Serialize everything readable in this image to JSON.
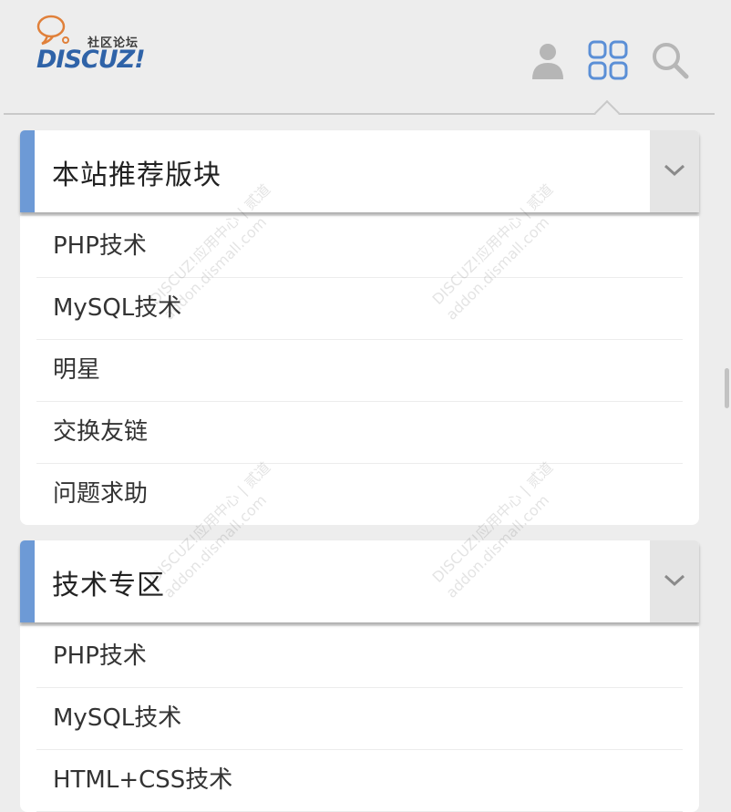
{
  "header": {
    "logo_text": "DISCUZ!",
    "logo_sub": "社区论坛",
    "icons": [
      "user-icon",
      "grid-icon",
      "search-icon"
    ]
  },
  "sections": [
    {
      "title": "本站推荐版块",
      "items": [
        "PHP技术",
        "MySQL技术",
        "明星",
        "交换友链",
        "问题求助"
      ]
    },
    {
      "title": "技术专区",
      "items": [
        "PHP技术",
        "MySQL技术",
        "HTML+CSS技术"
      ]
    }
  ],
  "watermark": {
    "brand": "DISCUZ!应用中心",
    "url": "addon.dismall.com",
    "tag": "贰道"
  },
  "colors": {
    "accent": "#6d9ad6",
    "logo_blue": "#2f63a8",
    "icon_blue": "#5b8fd6",
    "icon_gray": "#b6b6b6"
  }
}
